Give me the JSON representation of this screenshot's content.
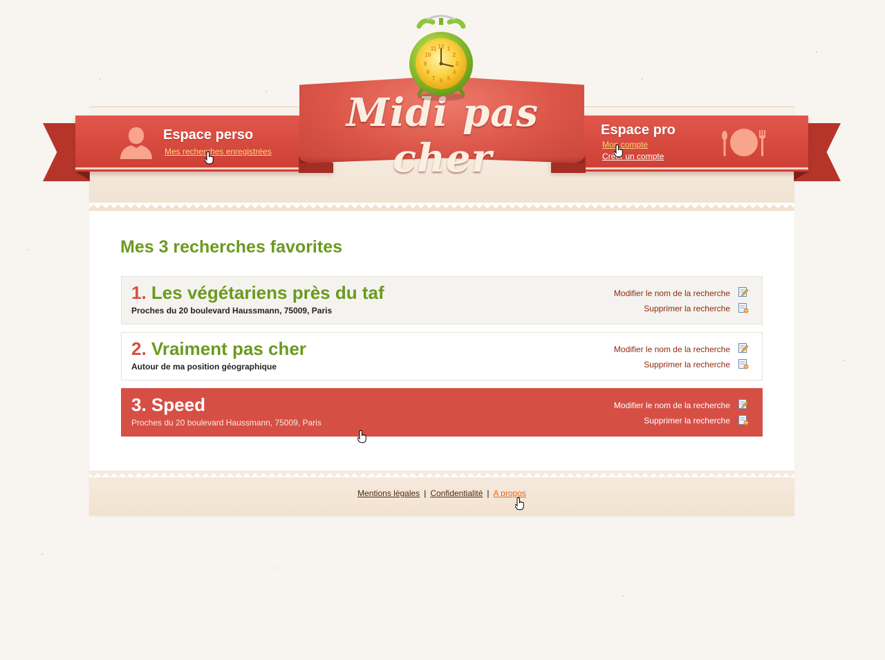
{
  "brand": {
    "name": "Midi pas cher"
  },
  "header": {
    "perso": {
      "title": "Espace perso",
      "link": "Mes recherches enregistrées"
    },
    "pro": {
      "title": "Espace pro",
      "link_account": "Mon compte",
      "link_create": "Créer un compte"
    }
  },
  "main": {
    "title": "Mes 3 recherches favorites",
    "searches": [
      {
        "number": "1.",
        "name": "Les végétariens près du taf",
        "location": "Proches du 20 boulevard Haussmann, 75009, Paris",
        "rename_label": "Modifier le nom de la recherche",
        "delete_label": "Supprimer la recherche"
      },
      {
        "number": "2.",
        "name": "Vraiment pas cher",
        "location": "Autour de ma position géographique",
        "rename_label": "Modifier le nom de la recherche",
        "delete_label": "Supprimer la recherche"
      },
      {
        "number": "3.",
        "name": "Speed",
        "location": "Proches du 20 boulevard Haussmann, 75009, Paris",
        "rename_label": "Modifier le nom de la recherche",
        "delete_label": "Supprimer la recherche"
      }
    ]
  },
  "footer": {
    "links": [
      "Mentions légales",
      "Confidentialité",
      "A propos"
    ],
    "separator": "|"
  },
  "colors": {
    "ribbon": "#d64f45",
    "title_green": "#6a9a1f",
    "background": "#f8f5f0",
    "link_orange": "#e06a1a"
  },
  "clock": {
    "numbers": [
      "12",
      "1",
      "2",
      "3",
      "4",
      "5",
      "6",
      "7",
      "8",
      "9",
      "10",
      "11"
    ]
  }
}
